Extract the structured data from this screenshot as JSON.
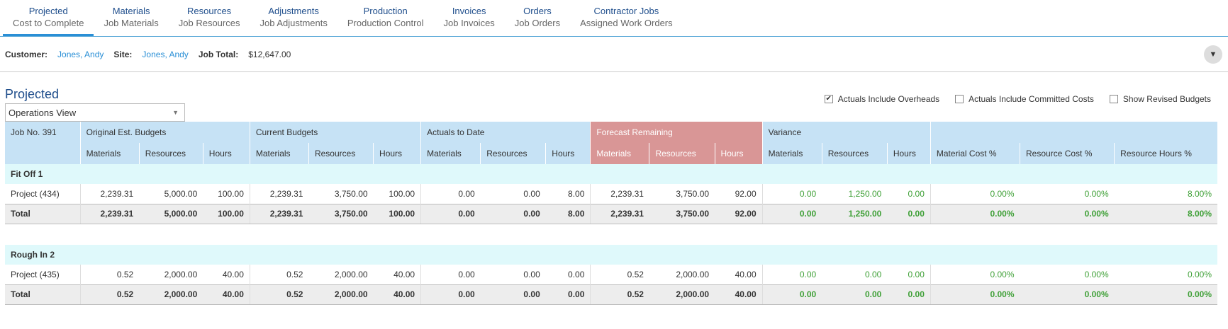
{
  "tabs": [
    {
      "title": "Projected",
      "subtitle": "Cost to Complete"
    },
    {
      "title": "Materials",
      "subtitle": "Job Materials"
    },
    {
      "title": "Resources",
      "subtitle": "Job Resources"
    },
    {
      "title": "Adjustments",
      "subtitle": "Job Adjustments"
    },
    {
      "title": "Production",
      "subtitle": "Production Control"
    },
    {
      "title": "Invoices",
      "subtitle": "Job Invoices"
    },
    {
      "title": "Orders",
      "subtitle": "Job Orders"
    },
    {
      "title": "Contractor Jobs",
      "subtitle": "Assigned Work Orders"
    }
  ],
  "info": {
    "customer_label": "Customer:",
    "customer": "Jones, Andy",
    "site_label": "Site:",
    "site": "Jones, Andy",
    "total_label": "Job Total:",
    "total": "$12,647.00",
    "collapse_glyph": "▼"
  },
  "page": {
    "title": "Projected",
    "view": "Operations View",
    "view_arrow": "▼"
  },
  "options": [
    {
      "label": "Actuals Include Overheads",
      "checked": true,
      "mark": "✔"
    },
    {
      "label": "Actuals Include Committed Costs",
      "checked": false,
      "mark": ""
    },
    {
      "label": "Show Revised Budgets",
      "checked": false,
      "mark": ""
    }
  ],
  "table": {
    "job": "Job No. 391",
    "groups": [
      "Original Est. Budgets",
      "Current Budgets",
      "Actuals to Date",
      "Forecast Remaining",
      "Variance",
      ""
    ],
    "columns": [
      "Materials",
      "Resources",
      "Hours",
      "Materials",
      "Resources",
      "Hours",
      "Materials",
      "Resources",
      "Hours",
      "Materials",
      "Resources",
      "Hours",
      "Materials",
      "Resources",
      "Hours",
      "Material Cost %",
      "Resource Cost %",
      "Resource Hours %"
    ],
    "sections": [
      {
        "name": "Fit Off 1",
        "row": {
          "label": "Project (434)",
          "values": [
            "2,239.31",
            "5,000.00",
            "100.00",
            "2,239.31",
            "3,750.00",
            "100.00",
            "0.00",
            "0.00",
            "8.00",
            "2,239.31",
            "3,750.00",
            "92.00",
            "0.00",
            "1,250.00",
            "0.00",
            "0.00%",
            "0.00%",
            "8.00%"
          ]
        },
        "total": {
          "label": "Total",
          "values": [
            "2,239.31",
            "5,000.00",
            "100.00",
            "2,239.31",
            "3,750.00",
            "100.00",
            "0.00",
            "0.00",
            "8.00",
            "2,239.31",
            "3,750.00",
            "92.00",
            "0.00",
            "1,250.00",
            "0.00",
            "0.00%",
            "0.00%",
            "8.00%"
          ]
        }
      },
      {
        "name": "Rough In 2",
        "row": {
          "label": "Project (435)",
          "values": [
            "0.52",
            "2,000.00",
            "40.00",
            "0.52",
            "2,000.00",
            "40.00",
            "0.00",
            "0.00",
            "0.00",
            "0.52",
            "2,000.00",
            "40.00",
            "0.00",
            "0.00",
            "0.00",
            "0.00%",
            "0.00%",
            "0.00%"
          ]
        },
        "total": {
          "label": "Total",
          "values": [
            "0.52",
            "2,000.00",
            "40.00",
            "0.52",
            "2,000.00",
            "40.00",
            "0.00",
            "0.00",
            "0.00",
            "0.52",
            "2,000.00",
            "40.00",
            "0.00",
            "0.00",
            "0.00",
            "0.00%",
            "0.00%",
            "0.00%"
          ]
        }
      }
    ]
  }
}
